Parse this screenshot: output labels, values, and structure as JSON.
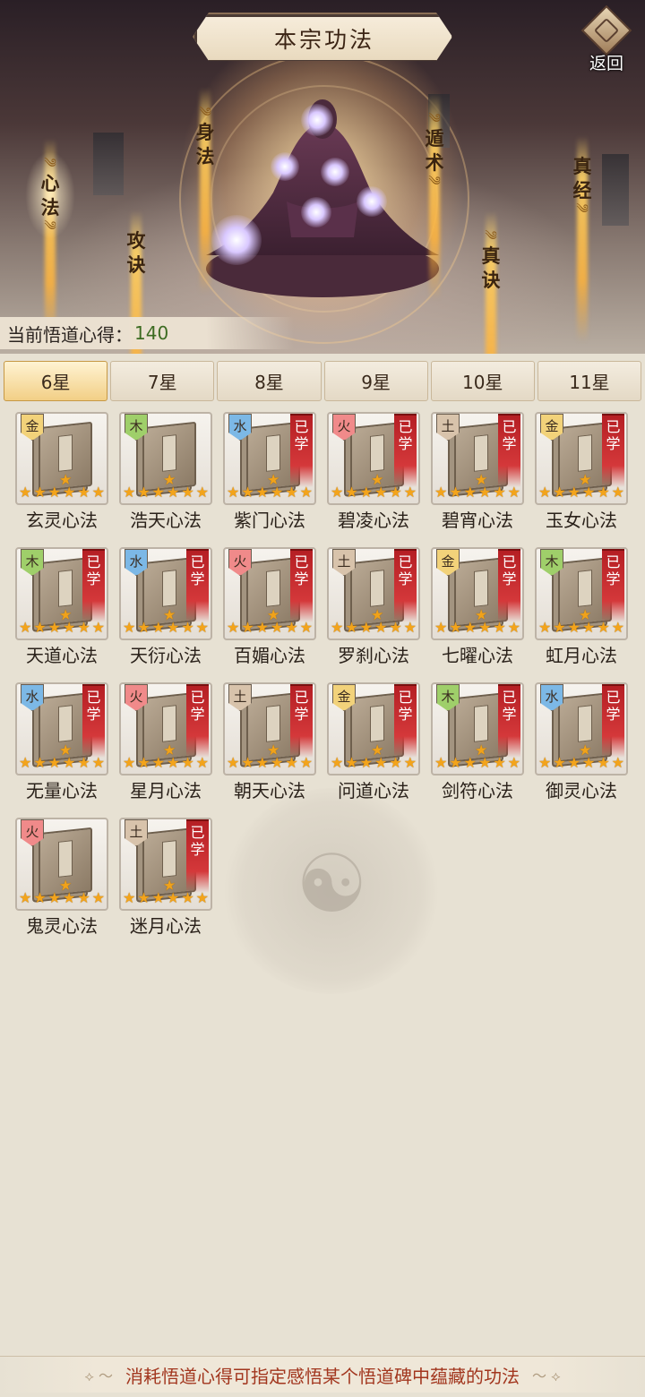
{
  "header": {
    "title": "本宗功法",
    "back_label": "返回"
  },
  "categories": [
    {
      "id": "xinfa",
      "label_top": "心",
      "label_bottom": "法"
    },
    {
      "id": "gongjue",
      "label_top": "攻",
      "label_bottom": "诀"
    },
    {
      "id": "shenfa",
      "label_top": "身",
      "label_bottom": "法"
    },
    {
      "id": "dunshu",
      "label_top": "遁",
      "label_bottom": "术"
    },
    {
      "id": "zhenjue",
      "label_top": "真",
      "label_bottom": "诀"
    },
    {
      "id": "zhenjing",
      "label_top": "真",
      "label_bottom": "经"
    }
  ],
  "insight": {
    "label": "当前悟道心得：",
    "value": "140"
  },
  "tabs": [
    {
      "label": "6星",
      "active": true
    },
    {
      "label": "7星",
      "active": false
    },
    {
      "label": "8星",
      "active": false
    },
    {
      "label": "9星",
      "active": false
    },
    {
      "label": "10星",
      "active": false
    },
    {
      "label": "11星",
      "active": false
    }
  ],
  "learned_label": "已学",
  "element_colors": {
    "金": "#f2d27a",
    "木": "#9fcf6a",
    "水": "#7cb8e6",
    "火": "#f08a8a",
    "土": "#d8c3ab"
  },
  "star_count": 6,
  "skills": [
    {
      "name": "玄灵心法",
      "element": "金",
      "learned": false
    },
    {
      "name": "浩天心法",
      "element": "木",
      "learned": false
    },
    {
      "name": "紫门心法",
      "element": "水",
      "learned": true
    },
    {
      "name": "碧凌心法",
      "element": "火",
      "learned": true
    },
    {
      "name": "碧宵心法",
      "element": "土",
      "learned": true
    },
    {
      "name": "玉女心法",
      "element": "金",
      "learned": true
    },
    {
      "name": "天道心法",
      "element": "木",
      "learned": true
    },
    {
      "name": "天衍心法",
      "element": "水",
      "learned": true
    },
    {
      "name": "百媚心法",
      "element": "火",
      "learned": true
    },
    {
      "name": "罗刹心法",
      "element": "土",
      "learned": true
    },
    {
      "name": "七曜心法",
      "element": "金",
      "learned": true
    },
    {
      "name": "虹月心法",
      "element": "木",
      "learned": true
    },
    {
      "name": "无量心法",
      "element": "水",
      "learned": true
    },
    {
      "name": "星月心法",
      "element": "火",
      "learned": true
    },
    {
      "name": "朝天心法",
      "element": "土",
      "learned": true
    },
    {
      "name": "问道心法",
      "element": "金",
      "learned": true
    },
    {
      "name": "剑符心法",
      "element": "木",
      "learned": true
    },
    {
      "name": "御灵心法",
      "element": "水",
      "learned": true
    },
    {
      "name": "鬼灵心法",
      "element": "火",
      "learned": false
    },
    {
      "name": "迷月心法",
      "element": "土",
      "learned": true
    }
  ],
  "footer": {
    "text": "消耗悟道心得可指定感悟某个悟道碑中蕴藏的功法"
  }
}
